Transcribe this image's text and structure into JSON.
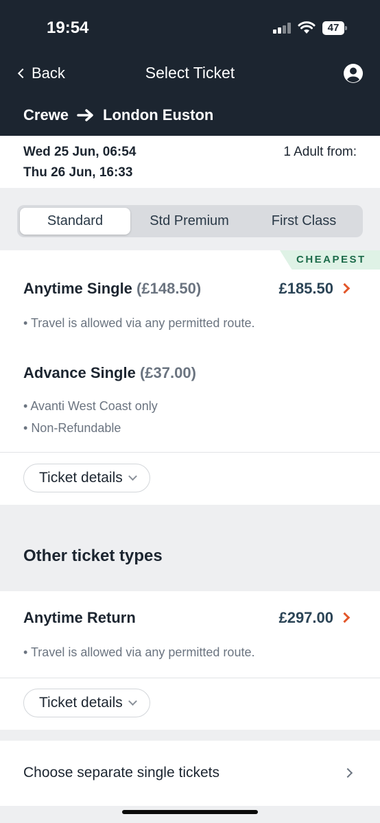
{
  "status_bar": {
    "time": "19:54",
    "battery": "47"
  },
  "nav": {
    "back_label": "Back",
    "title": "Select Ticket"
  },
  "route": {
    "from": "Crewe",
    "to": "London Euston"
  },
  "dates": {
    "outbound": "Wed 25 Jun, 06:54",
    "return": "Thu 26 Jun, 16:33",
    "passengers": "1 Adult from:"
  },
  "tabs": [
    {
      "label": "Standard",
      "active": true
    },
    {
      "label": "Std Premium",
      "active": false
    },
    {
      "label": "First Class",
      "active": false
    }
  ],
  "main_card": {
    "badge": "CHEAPEST",
    "tickets": [
      {
        "name": "Anytime Single",
        "sub_price": "(£148.50)",
        "price": "£185.50",
        "bullets": [
          "Travel is allowed via any permitted route."
        ]
      },
      {
        "name": "Advance Single",
        "sub_price": "(£37.00)",
        "bullets": [
          "Avanti West Coast only",
          "Non-Refundable"
        ]
      }
    ],
    "details_label": "Ticket details"
  },
  "other": {
    "section_title": "Other ticket types",
    "ticket": {
      "name": "Anytime Return",
      "price": "£297.00",
      "bullets": [
        "Travel is allowed via any permitted route."
      ]
    },
    "details_label": "Ticket details"
  },
  "separate": {
    "label": "Choose separate single tickets"
  },
  "colors": {
    "header_bg": "#1c2530",
    "accent": "#e2572b",
    "price": "#2b4456",
    "badge_bg": "#dff2e6",
    "badge_text": "#1c6b4a"
  }
}
